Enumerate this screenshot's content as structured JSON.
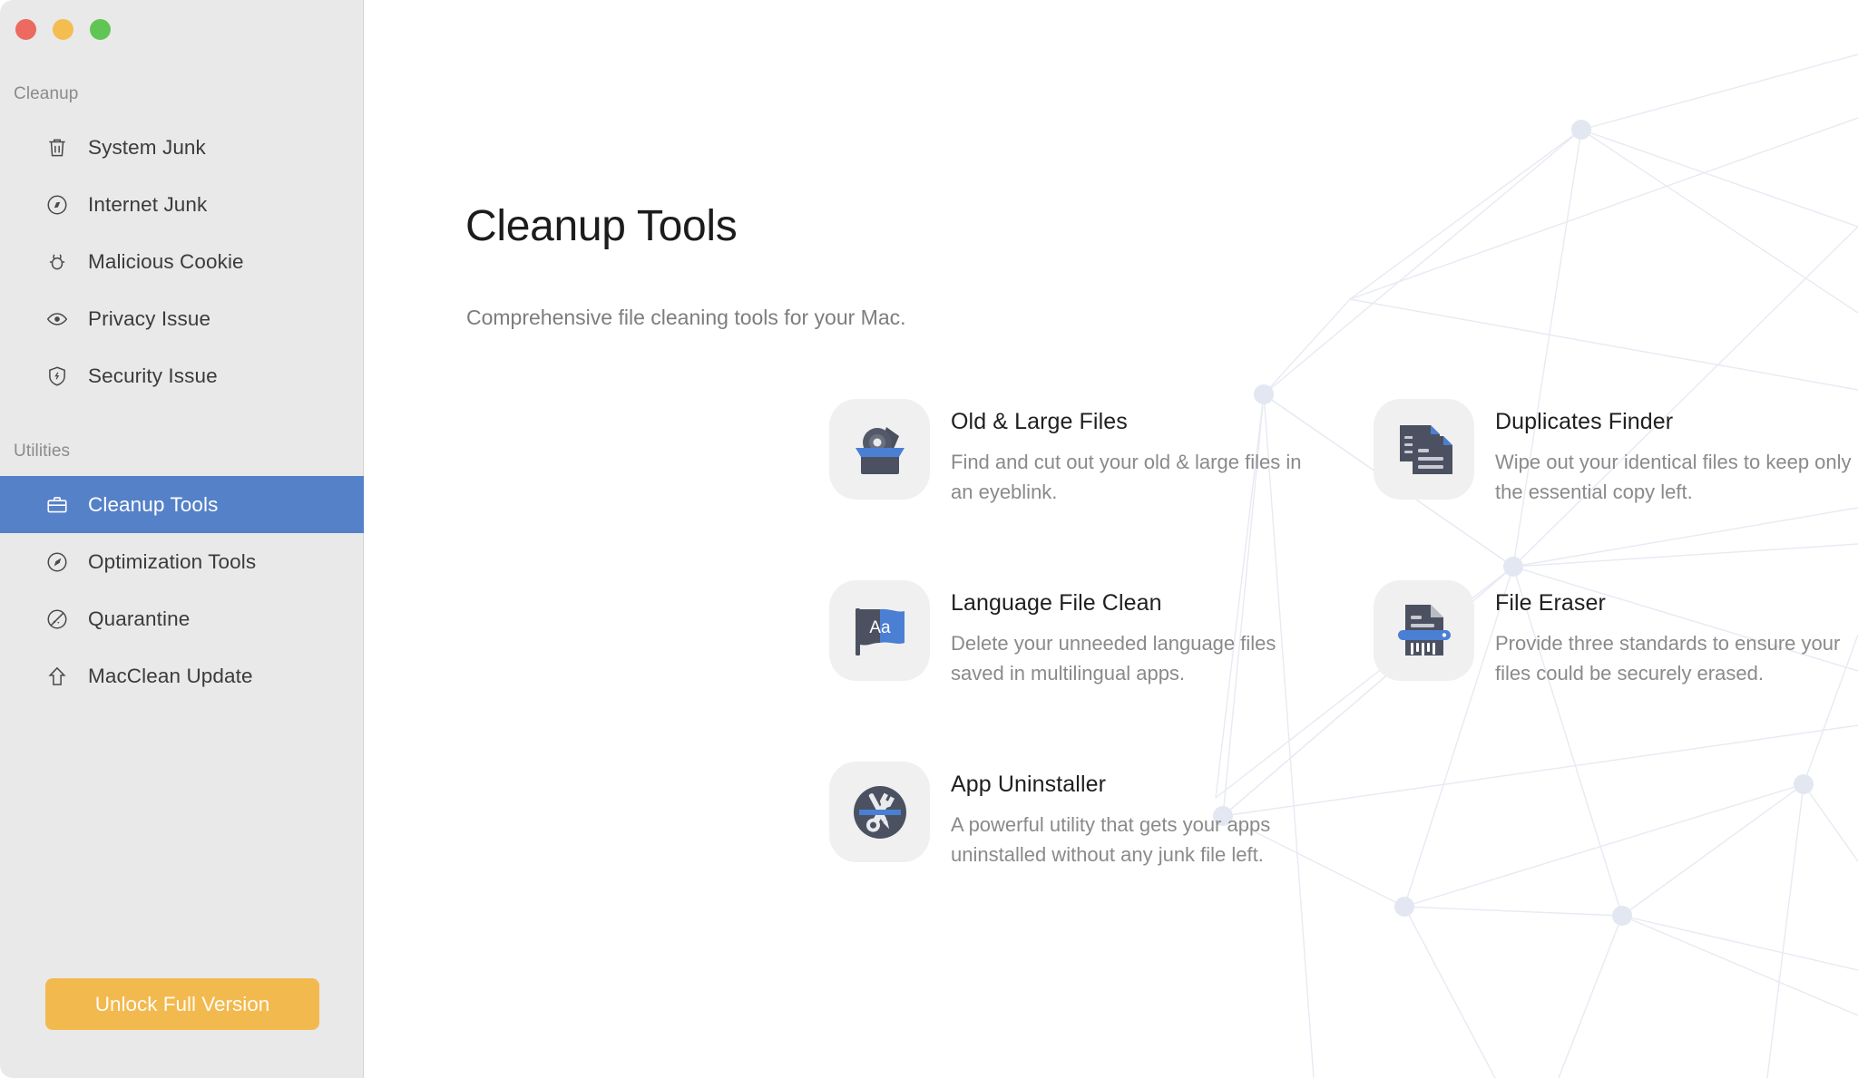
{
  "window": {
    "traffic_lights": [
      {
        "name": "close",
        "color": "#ec6a5f"
      },
      {
        "name": "minimize",
        "color": "#f4bd50"
      },
      {
        "name": "zoom",
        "color": "#61c555"
      }
    ]
  },
  "sidebar": {
    "groups": [
      {
        "label": "Cleanup",
        "items": [
          {
            "label": "System Junk",
            "icon": "trash-icon",
            "selected": false
          },
          {
            "label": "Internet Junk",
            "icon": "compass-icon",
            "selected": false
          },
          {
            "label": "Malicious Cookie",
            "icon": "bug-icon",
            "selected": false
          },
          {
            "label": "Privacy Issue",
            "icon": "eye-icon",
            "selected": false
          },
          {
            "label": "Security Issue",
            "icon": "shield-icon",
            "selected": false
          }
        ]
      },
      {
        "label": "Utilities",
        "items": [
          {
            "label": "Cleanup Tools",
            "icon": "briefcase-icon",
            "selected": true
          },
          {
            "label": "Optimization Tools",
            "icon": "speedometer-icon",
            "selected": false
          },
          {
            "label": "Quarantine",
            "icon": "quarantine-icon",
            "selected": false
          },
          {
            "label": "MacClean Update",
            "icon": "up-arrow-icon",
            "selected": false
          }
        ]
      }
    ],
    "unlock_button": "Unlock Full Version",
    "selected_color": "#5581c8",
    "unlock_color": "#f2b94f"
  },
  "main": {
    "title": "Cleanup Tools",
    "subtitle": "Comprehensive file cleaning tools for your Mac.",
    "tools": [
      {
        "name": "Old & Large Files",
        "desc": "Find and cut out your old & large files in an eyeblink.",
        "icon": "old-large-files-icon"
      },
      {
        "name": "Duplicates Finder",
        "desc": "Wipe out your identical files to keep only the essential copy left.",
        "icon": "duplicates-finder-icon"
      },
      {
        "name": "Language File Clean",
        "desc": "Delete your unneeded language files saved in multilingual apps.",
        "icon": "language-file-clean-icon",
        "icon_text": "Aa"
      },
      {
        "name": "File Eraser",
        "desc": "Provide three standards to ensure your files could be securely erased.",
        "icon": "file-eraser-icon"
      },
      {
        "name": "App Uninstaller",
        "desc": "A powerful utility that gets your apps uninstalled without any junk file left.",
        "icon": "app-uninstaller-icon"
      }
    ],
    "accent_blue": "#4a7fd4",
    "icon_dark": "#4b5160",
    "background_graphic": "network-constellation"
  }
}
